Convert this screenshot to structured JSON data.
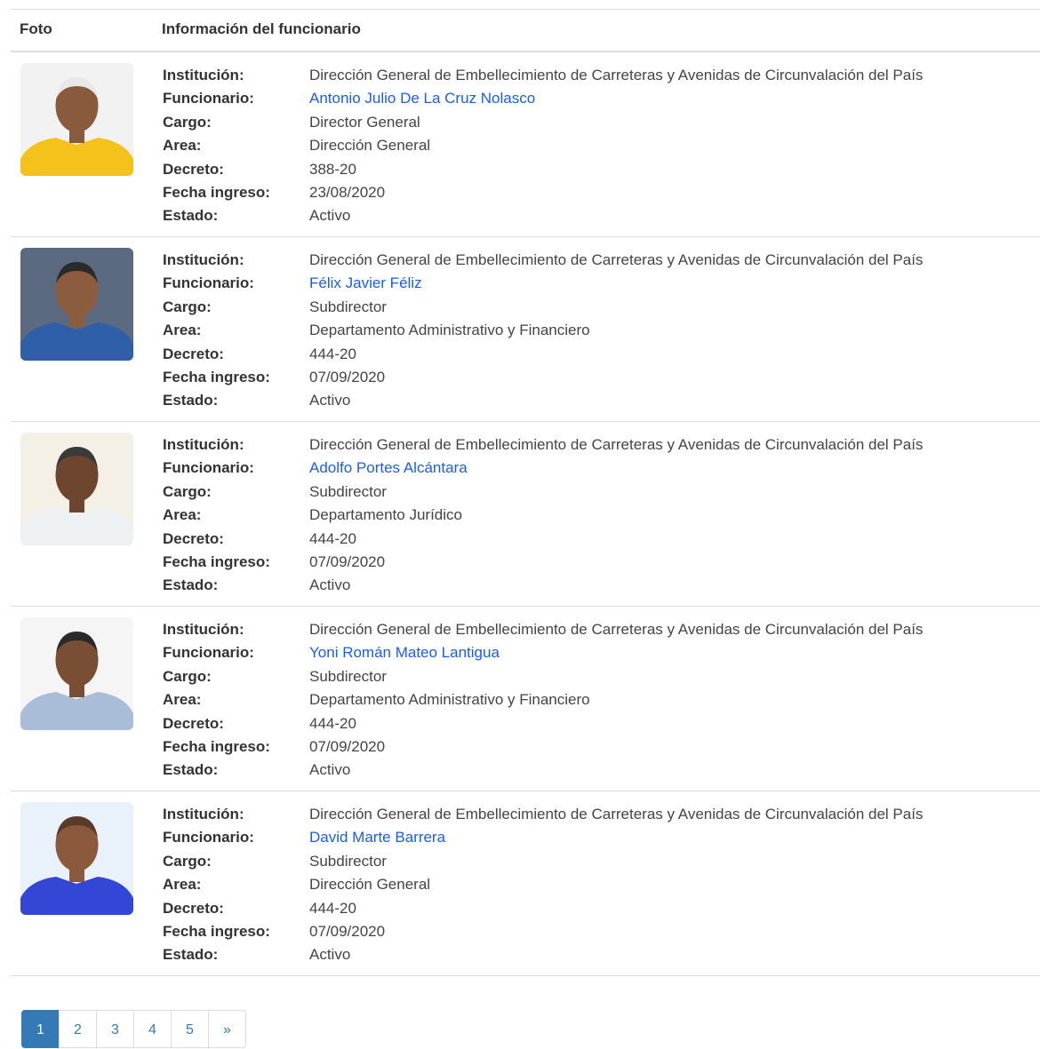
{
  "table": {
    "headers": {
      "photo": "Foto",
      "info": "Información del funcionario"
    },
    "labels": {
      "institucion": "Institución:",
      "funcionario": "Funcionario:",
      "cargo": "Cargo:",
      "area": "Area:",
      "decreto": "Decreto:",
      "fecha_ingreso": "Fecha ingreso:",
      "estado": "Estado:"
    },
    "rows": [
      {
        "institucion": "Dirección General de Embellecimiento de Carreteras y Avenidas de Circunvalación del País",
        "funcionario": "Antonio Julio De La Cruz Nolasco",
        "cargo": "Director General",
        "area": "Dirección General",
        "decreto": "388-20",
        "fecha_ingreso": "23/08/2020",
        "estado": "Activo"
      },
      {
        "institucion": "Dirección General de Embellecimiento de Carreteras y Avenidas de Circunvalación del País",
        "funcionario": "Félix Javier Féliz",
        "cargo": "Subdirector",
        "area": "Departamento Administrativo y Financiero",
        "decreto": "444-20",
        "fecha_ingreso": "07/09/2020",
        "estado": "Activo"
      },
      {
        "institucion": "Dirección General de Embellecimiento de Carreteras y Avenidas de Circunvalación del País",
        "funcionario": "Adolfo Portes Alcántara",
        "cargo": "Subdirector",
        "area": "Departamento Jurídico",
        "decreto": "444-20",
        "fecha_ingreso": "07/09/2020",
        "estado": "Activo"
      },
      {
        "institucion": "Dirección General de Embellecimiento de Carreteras y Avenidas de Circunvalación del País",
        "funcionario": "Yoni Román Mateo Lantigua",
        "cargo": "Subdirector",
        "area": "Departamento Administrativo y Financiero",
        "decreto": "444-20",
        "fecha_ingreso": "07/09/2020",
        "estado": "Activo"
      },
      {
        "institucion": "Dirección General de Embellecimiento de Carreteras y Avenidas de Circunvalación del País",
        "funcionario": "David Marte Barrera",
        "cargo": "Subdirector",
        "area": "Dirección General",
        "decreto": "444-20",
        "fecha_ingreso": "07/09/2020",
        "estado": "Activo"
      }
    ]
  },
  "photos": [
    {
      "bg": "#f2f2f2",
      "clothing": "#f5c21b",
      "skin": "#8a5a3c",
      "hair": "#e8e8e8"
    },
    {
      "bg": "#5b6a80",
      "clothing": "#2f5fa8",
      "skin": "#8c5c3e",
      "hair": "#2a2a2a"
    },
    {
      "bg": "#f4f0e6",
      "clothing": "#eef1f4",
      "skin": "#6e4630",
      "hair": "#3a3a3a"
    },
    {
      "bg": "#f5f5f5",
      "clothing": "#a9bdd8",
      "skin": "#7a4e34",
      "hair": "#2a2a2a"
    },
    {
      "bg": "#e9f2fb",
      "clothing": "#3346d6",
      "skin": "#8b5a3c",
      "hair": "#5a3a2a"
    }
  ],
  "pagination": {
    "pages": [
      "1",
      "2",
      "3",
      "4",
      "5"
    ],
    "next": "»",
    "active": "1"
  }
}
